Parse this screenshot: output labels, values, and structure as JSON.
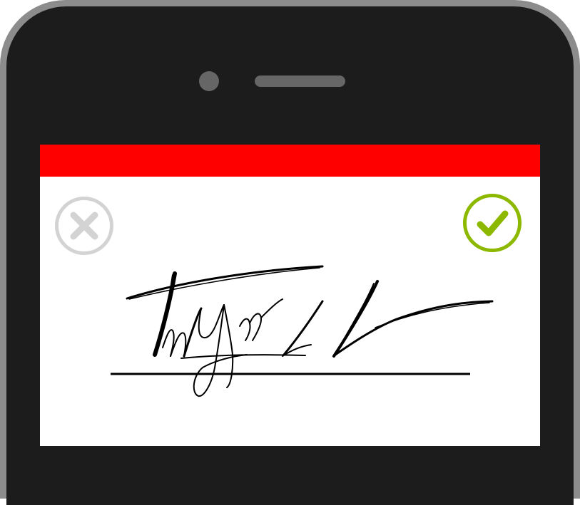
{
  "device": {
    "frame_color": "#8c8c8c",
    "body_color": "#1c1c1c"
  },
  "screen": {
    "status_bar_color": "#ff0000",
    "background": "#ffffff"
  },
  "actions": {
    "cancel_icon": "x-circle-icon",
    "cancel_color": "#d3d3d3",
    "confirm_icon": "check-circle-icon",
    "confirm_color": "#8cb800"
  },
  "signature": {
    "line_color": "#000000",
    "ink_color": "#000000"
  }
}
